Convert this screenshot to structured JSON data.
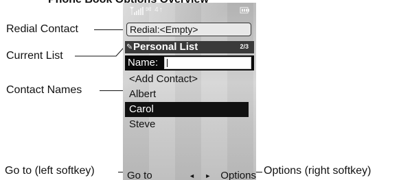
{
  "page_title": "Phone Book Options Overview",
  "callouts": {
    "redial_contact": "Redial Contact",
    "current_list": "Current List",
    "contact_names": "Contact Names",
    "go_to_left_softkey": "Go to (left softkey)",
    "options_right_softkey": "Options (right softkey)"
  },
  "screen": {
    "status_icons": "✉ 4↑",
    "redial_value": "Redial:<Empty>",
    "list_header": {
      "title": "Personal List",
      "page_indicator": "2/3"
    },
    "name_field_label": "Name:",
    "name_field_value": "",
    "contacts": [
      "<Add Contact>",
      "Albert",
      "Carol",
      "Steve"
    ],
    "selected_contact": "Carol",
    "softkeys": {
      "left": "Go to",
      "nav_arrows": "◄ ►",
      "right": "Options"
    }
  }
}
